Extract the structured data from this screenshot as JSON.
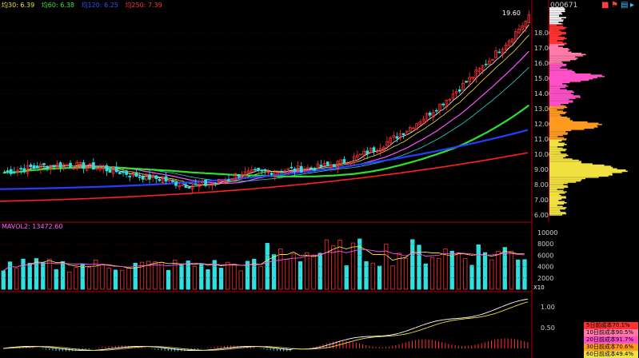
{
  "legend": [
    {
      "label": "均30: 6.39",
      "color": "#f0e040"
    },
    {
      "label": "均60: 6.38",
      "color": "#40e040"
    },
    {
      "label": "均120: 6.25",
      "color": "#3050ff"
    },
    {
      "label": "均250: 7.39",
      "color": "#ff3030"
    }
  ],
  "stock_code": "000671",
  "high_label": "19.60",
  "price_axis": [
    "18.00",
    "17.00",
    "16.00",
    "15.00",
    "14.00",
    "13.00",
    "12.00",
    "11.00",
    "10.00",
    "9.00",
    "8.00",
    "7.00",
    "6.00"
  ],
  "volume_legend": "MAVOL2: 13472.60",
  "volume_axis": [
    "10000",
    "8000",
    "6000",
    "4000",
    "2000"
  ],
  "volume_unit": "X10",
  "macd_axis": [
    "1.00",
    "0.50"
  ],
  "cost_distribution": [
    {
      "label": "5日前成本70.1%",
      "color": "#ff3030"
    },
    {
      "label": "10日前成本90.5%",
      "color": "#ff7aa8"
    },
    {
      "label": "20日前成本91.7%",
      "color": "#ff50c8"
    },
    {
      "label": "30日前成本70.6%",
      "color": "#ff9a20"
    },
    {
      "label": "60日前成本49.4%",
      "color": "#f0e040"
    }
  ],
  "colors": {
    "up": "#ff3030",
    "down": "#30e0e0",
    "grid": "#8b0000",
    "frame": "#b00000"
  }
}
